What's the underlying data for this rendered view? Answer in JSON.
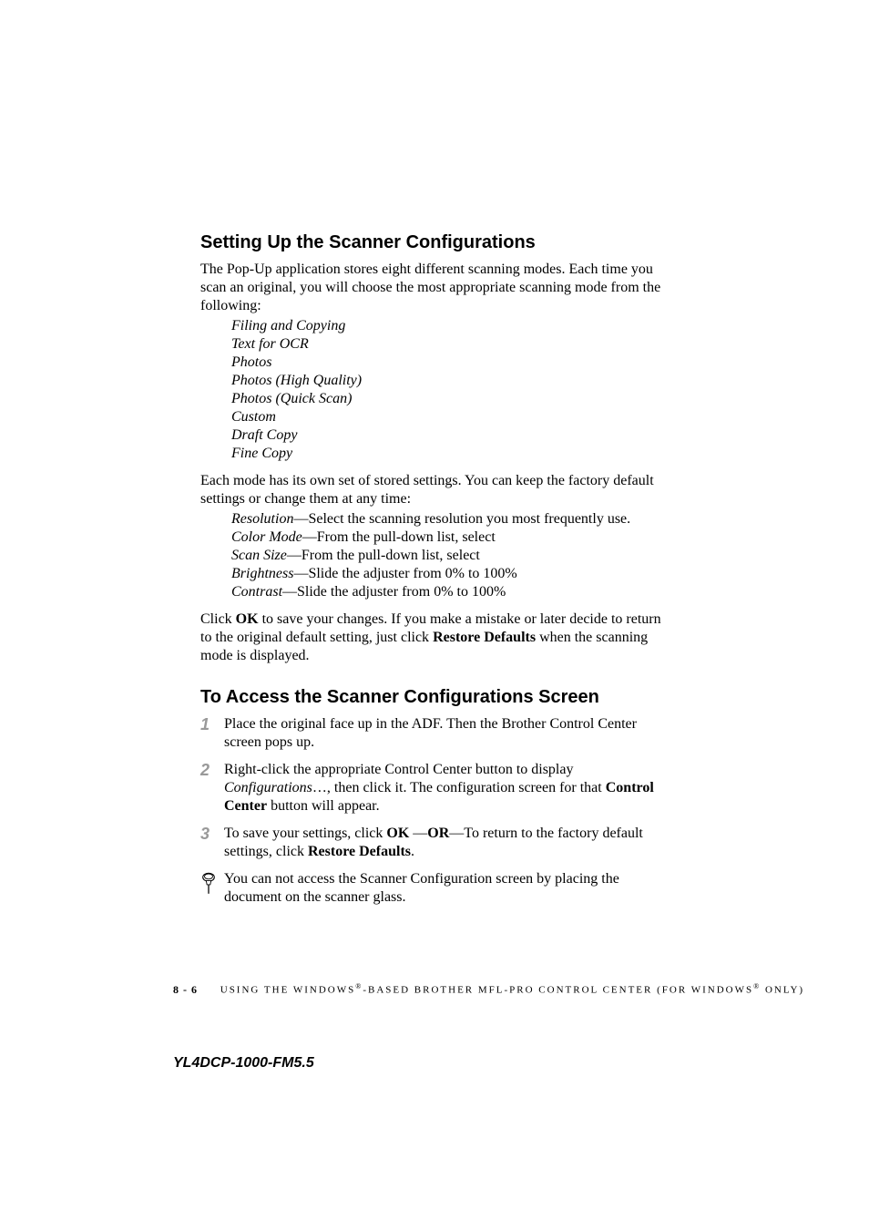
{
  "h1": "Setting Up the Scanner Configurations",
  "p1": "The Pop-Up application stores eight different scanning modes. Each time you scan an original, you will choose the most appropriate scanning mode from the following:",
  "modes": [
    "Filing and Copying",
    "Text for OCR",
    "Photos",
    "Photos (High Quality)",
    "Photos (Quick Scan)",
    "Custom",
    "Draft Copy",
    "Fine Copy"
  ],
  "p2": "Each mode has its own set of stored settings. You can keep the factory default settings or change them at any time:",
  "settings": [
    {
      "term": "Resolution",
      "desc": "—Select the scanning resolution you most frequently use."
    },
    {
      "term": "Color Mode",
      "desc": "—From the pull-down list, select"
    },
    {
      "term": "Scan Size",
      "desc": "—From the pull-down list, select"
    },
    {
      "term": "Brightness",
      "desc": "—Slide the adjuster from 0% to 100%"
    },
    {
      "term": "Contrast",
      "desc": "—Slide the adjuster from 0% to 100%"
    }
  ],
  "p3_a": "Click ",
  "p3_ok": "OK",
  "p3_b": " to save your changes. If you make a mistake or later decide to return to the original default setting, just click ",
  "p3_rd": "Restore Defaults",
  "p3_c": " when the scanning mode is displayed.",
  "h2": "To Access the Scanner Configurations Screen",
  "steps": {
    "n1": "1",
    "s1": "Place the original face up in the ADF. Then the Brother Control Center screen pops up.",
    "n2": "2",
    "s2_a": "Right-click the appropriate Control Center button to display ",
    "s2_i": "Configurations",
    "s2_b": "…, then click it. The configuration screen for that ",
    "s2_bold": "Control Center",
    "s2_c": " button will appear.",
    "n3": "3",
    "s3_a": "To save your settings, click ",
    "s3_ok": "OK",
    "s3_b": " —",
    "s3_or": "OR",
    "s3_c": "—To return to the factory default settings, click ",
    "s3_rd": "Restore Defaults",
    "s3_d": "."
  },
  "note": "You can not access the Scanner Configuration screen by placing the document on the scanner glass.",
  "footer": {
    "page": "8 - 6",
    "text_a": "USING THE WINDOWS",
    "sup": "®",
    "text_b": "-BASED BROTHER MFL-PRO CONTROL CENTER (FOR WINDOWS",
    "text_c": " ONLY)"
  },
  "docid": "YL4DCP-1000-FM5.5"
}
